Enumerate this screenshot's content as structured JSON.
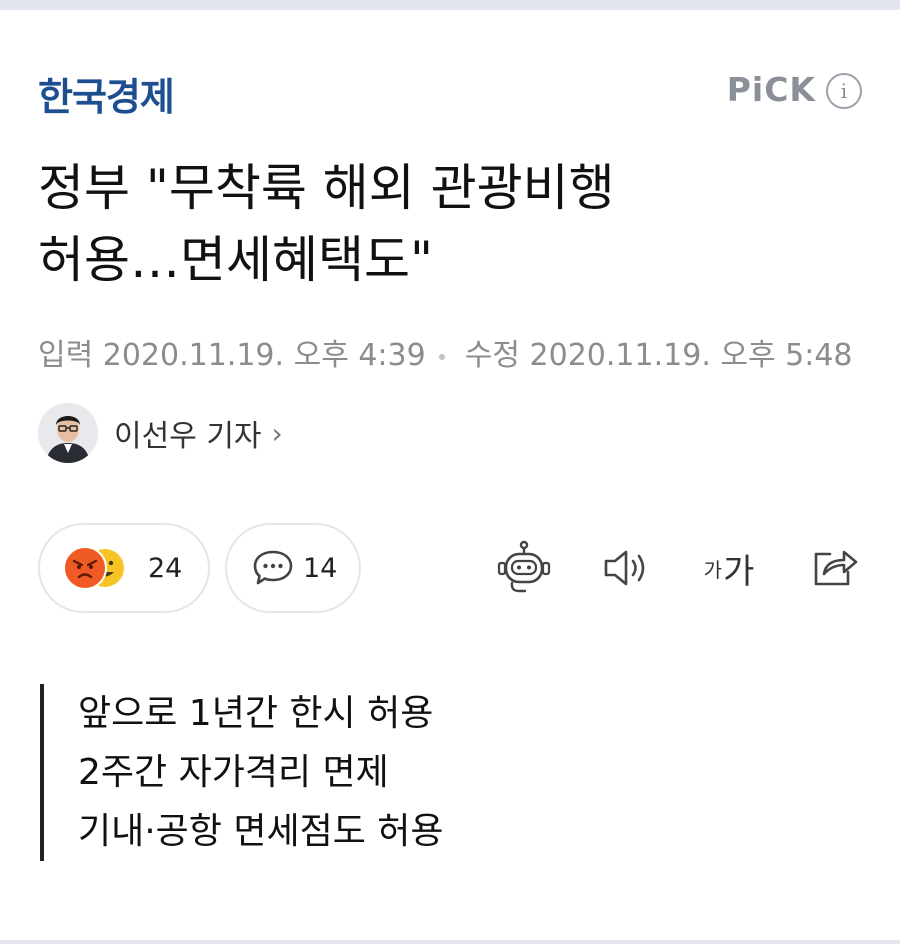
{
  "press": {
    "logo_text": "한국경제",
    "pick_label": "PiCK",
    "info_symbol": "i"
  },
  "article": {
    "title_line1": "정부 \"무착륙 해외 관광비행",
    "title_line2": "허용…면세혜택도\"",
    "input_label": "입력",
    "input_time": "2020.11.19. 오후 4:39",
    "edit_label": "수정",
    "edit_time": "2020.11.19. 오후 5:48",
    "author": {
      "name": "이선우 기자",
      "chevron": "›"
    }
  },
  "actions": {
    "reaction_count": "24",
    "comment_count": "14",
    "font_size_small": "가",
    "font_size_large": "가"
  },
  "summary": [
    "앞으로 1년간 한시 허용",
    "2주간 자가격리 면제",
    "기내·공항 면세점도 허용"
  ],
  "colors": {
    "brand": "#1d4e8f",
    "muted": "#8c8c8c",
    "angry": "#f05a24",
    "smile": "#f7c325"
  }
}
